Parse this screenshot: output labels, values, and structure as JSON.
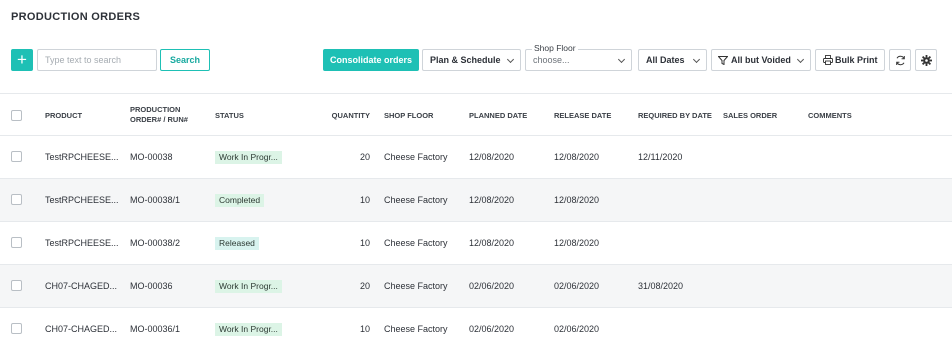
{
  "page": {
    "title": "PRODUCTION ORDERS"
  },
  "toolbar": {
    "add_label": "+",
    "search_placeholder": "Type text to search",
    "search_label": "Search",
    "consolidate_label": "Consolidate orders",
    "plan_schedule_label": "Plan & Schedule",
    "shop_floor_legend": "Shop Floor",
    "shop_floor_value": "choose...",
    "dates_label": "All Dates",
    "status_filter_label": "All but Voided",
    "bulk_print_label": "Bulk Print"
  },
  "table": {
    "headers": {
      "product": "PRODUCT",
      "order_line1": "PRODUCTION",
      "order_line2": "ORDER# / RUN#",
      "status": "STATUS",
      "quantity": "QUANTITY",
      "shop_floor": "SHOP FLOOR",
      "planned_date": "PLANNED DATE",
      "release_date": "RELEASE DATE",
      "required_by_date": "REQUIRED BY DATE",
      "sales_order": "SALES ORDER",
      "comments": "COMMENTS"
    },
    "rows": [
      {
        "product": "TestRPCHEESE...",
        "order": "MO-00038",
        "status": "Work In Progr...",
        "status_color": "#dcf4e6",
        "quantity": "20",
        "shop_floor": "Cheese Factory",
        "planned_date": "12/08/2020",
        "release_date": "12/08/2020",
        "required_by_date": "12/11/2020",
        "sales_order": "",
        "comments": ""
      },
      {
        "product": "TestRPCHEESE...",
        "order": "MO-00038/1",
        "status": "Completed",
        "status_color": "#dcf4e6",
        "quantity": "10",
        "shop_floor": "Cheese Factory",
        "planned_date": "12/08/2020",
        "release_date": "12/08/2020",
        "required_by_date": "",
        "sales_order": "",
        "comments": ""
      },
      {
        "product": "TestRPCHEESE...",
        "order": "MO-00038/2",
        "status": "Released",
        "status_color": "#d8f3ef",
        "quantity": "10",
        "shop_floor": "Cheese Factory",
        "planned_date": "12/08/2020",
        "release_date": "12/08/2020",
        "required_by_date": "",
        "sales_order": "",
        "comments": ""
      },
      {
        "product": "CH07-CHAGED...",
        "order": "MO-00036",
        "status": "Work In Progr...",
        "status_color": "#dcf4e6",
        "quantity": "20",
        "shop_floor": "Cheese Factory",
        "planned_date": "02/06/2020",
        "release_date": "02/06/2020",
        "required_by_date": "31/08/2020",
        "sales_order": "",
        "comments": ""
      },
      {
        "product": "CH07-CHAGED...",
        "order": "MO-00036/1",
        "status": "Work In Progr...",
        "status_color": "#dcf4e6",
        "quantity": "10",
        "shop_floor": "Cheese Factory",
        "planned_date": "02/06/2020",
        "release_date": "02/06/2020",
        "required_by_date": "",
        "sales_order": "",
        "comments": ""
      }
    ]
  },
  "colors": {
    "accent": "#1ec0b5",
    "badge_green": "#dcf4e6",
    "badge_teal": "#d8f3ef"
  },
  "icons": [
    "plus-icon",
    "chevron-down-icon",
    "filter-icon",
    "printer-icon",
    "refresh-icon",
    "gear-icon",
    "checkbox-icon"
  ]
}
